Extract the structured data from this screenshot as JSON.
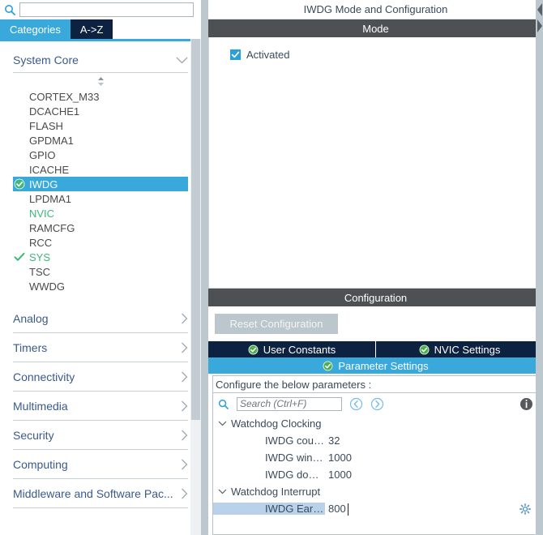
{
  "left": {
    "search": {
      "value": "",
      "placeholder": ""
    },
    "tabs": [
      {
        "label": "Categories",
        "active": true
      },
      {
        "label": "A->Z",
        "active": false
      }
    ],
    "system_core": {
      "label": "System Core"
    },
    "peripherals": [
      {
        "label": "CORTEX_M33",
        "state": "none"
      },
      {
        "label": "DCACHE1",
        "state": "none"
      },
      {
        "label": "FLASH",
        "state": "none"
      },
      {
        "label": "GPDMA1",
        "state": "none"
      },
      {
        "label": "GPIO",
        "state": "none"
      },
      {
        "label": "ICACHE",
        "state": "none"
      },
      {
        "label": "IWDG",
        "state": "configured-selected"
      },
      {
        "label": "LPDMA1",
        "state": "none"
      },
      {
        "label": "NVIC",
        "state": "green"
      },
      {
        "label": "RAMCFG",
        "state": "none"
      },
      {
        "label": "RCC",
        "state": "none"
      },
      {
        "label": "SYS",
        "state": "green-check"
      },
      {
        "label": "TSC",
        "state": "none"
      },
      {
        "label": "WWDG",
        "state": "none"
      }
    ],
    "categories": [
      {
        "label": "Analog"
      },
      {
        "label": "Timers"
      },
      {
        "label": "Connectivity"
      },
      {
        "label": "Multimedia"
      },
      {
        "label": "Security"
      },
      {
        "label": "Computing"
      },
      {
        "label": "Middleware and Software Pac..."
      }
    ]
  },
  "right": {
    "title": "IWDG Mode and Configuration",
    "mode": {
      "band": "Mode",
      "activated_label": "Activated",
      "activated_checked": true
    },
    "configuration": {
      "band": "Configuration",
      "reset_label": "Reset Configuration",
      "tabs_row1": [
        {
          "label": "User Constants",
          "selected": false
        },
        {
          "label": "NVIC Settings",
          "selected": false
        }
      ],
      "tabs_row2": [
        {
          "label": "Parameter Settings",
          "selected": true
        }
      ],
      "hint": "Configure the below parameters :",
      "search": {
        "value": "",
        "placeholder": "Search (Ctrl+F)"
      },
      "tree": [
        {
          "group": "Watchdog Clocking",
          "rows": [
            {
              "label": "IWDG counter clock ...",
              "value": "32",
              "selected": false,
              "gear": false
            },
            {
              "label": "IWDG window value",
              "value": "1000",
              "selected": false,
              "gear": false
            },
            {
              "label": "IWDG down-counter ...",
              "value": "1000",
              "selected": false,
              "gear": false
            }
          ]
        },
        {
          "group": "Watchdog Interrupt",
          "rows": [
            {
              "label": "IWDG Early Wakeup...",
              "value": "800",
              "selected": true,
              "gear": true
            }
          ]
        }
      ]
    }
  },
  "colors": {
    "accent_blue": "#39a9dc",
    "dark_navy": "#0d2240",
    "band_gray": "#4e5153",
    "green_check": "#3cb878",
    "selection_row": "#b9d2ea",
    "panel_border": "#bcc7ce"
  }
}
